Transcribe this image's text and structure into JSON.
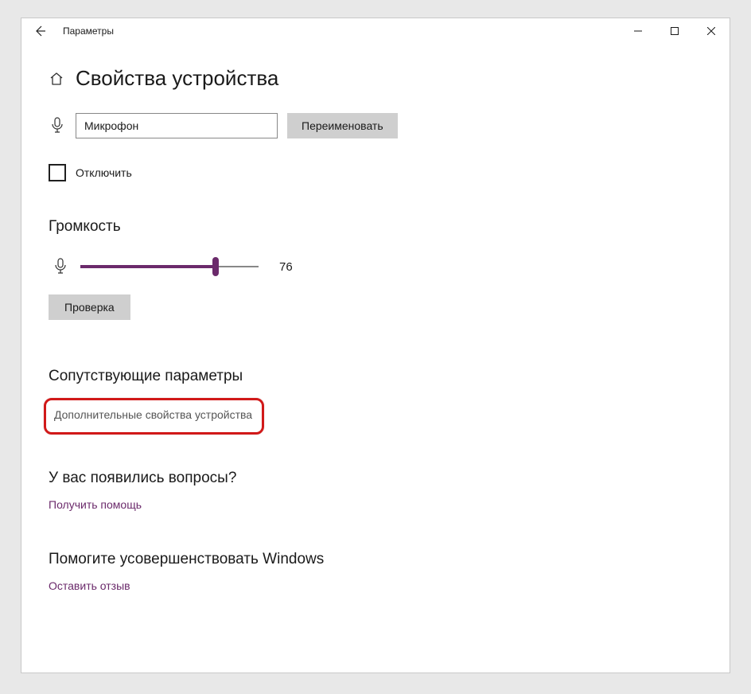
{
  "titlebar": {
    "label": "Параметры"
  },
  "page": {
    "title": "Свойства устройства"
  },
  "device": {
    "name_value": "Микрофон",
    "rename_btn": "Переименовать",
    "disable_label": "Отключить",
    "disable_checked": false
  },
  "volume": {
    "heading": "Громкость",
    "value": 76,
    "test_btn": "Проверка"
  },
  "related": {
    "heading": "Сопутствующие параметры",
    "advanced_link": "Дополнительные свойства устройства"
  },
  "questions": {
    "heading": "У вас появились вопросы?",
    "help_link": "Получить помощь"
  },
  "improve": {
    "heading": "Помогите усовершенствовать Windows",
    "feedback_link": "Оставить отзыв"
  },
  "colors": {
    "accent": "#6b2a6b",
    "highlight": "#d11919"
  }
}
